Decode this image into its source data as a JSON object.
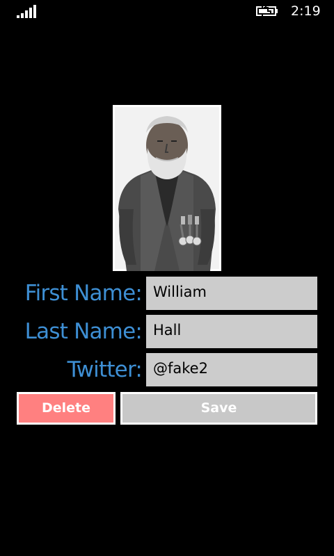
{
  "status_bar": {
    "time": "2:19",
    "signal_icon": "signal-strength-icon",
    "battery_icon": "battery-charging-icon"
  },
  "photo": {
    "subject": "portrait-photo"
  },
  "form": {
    "first_name_label": "First Name:",
    "first_name_value": "William",
    "last_name_label": "Last Name:",
    "last_name_value": "Hall",
    "twitter_label": "Twitter:",
    "twitter_value": "@fake2"
  },
  "actions": {
    "delete_label": "Delete",
    "save_label": "Save"
  },
  "colors": {
    "background": "#000000",
    "label_accent": "#3e8fd4",
    "field_bg": "#cccccc",
    "delete_bg": "#ff8080",
    "save_bg": "#c8c8c8",
    "button_border": "#ffffff"
  }
}
